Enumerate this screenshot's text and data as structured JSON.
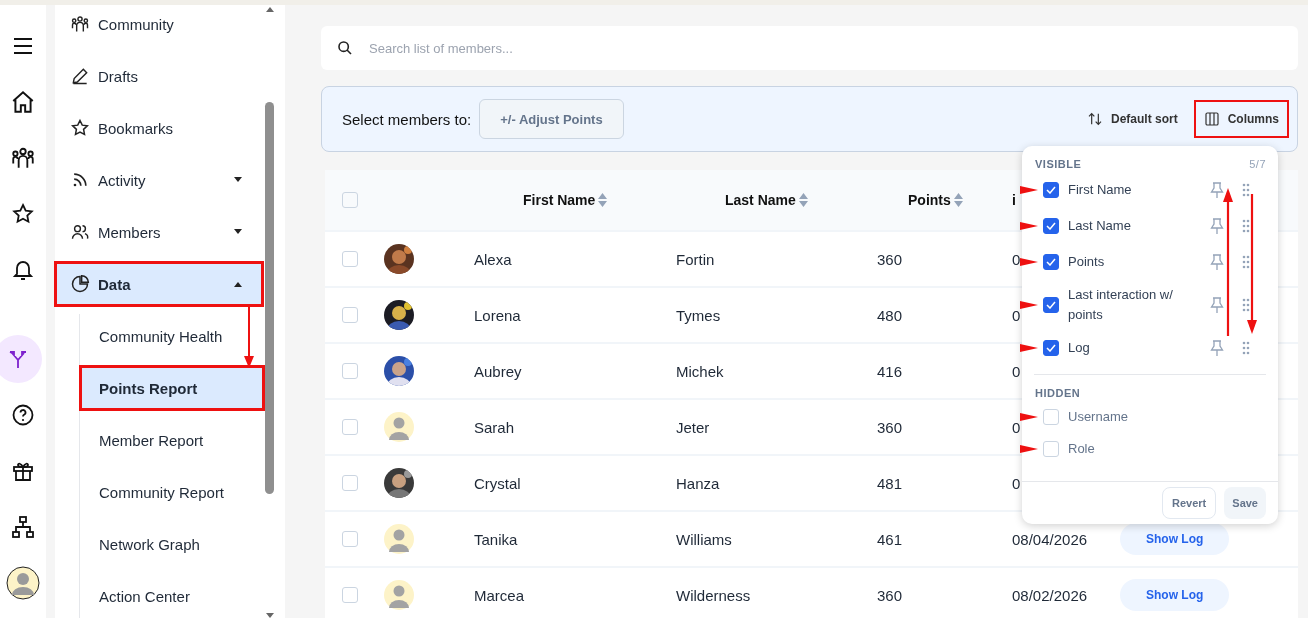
{
  "rail": [
    {
      "selected": false
    },
    {
      "selected": false
    },
    {
      "selected": false
    },
    {
      "selected": false
    },
    {
      "selected": false
    },
    {
      "selected": true
    },
    {
      "selected": false
    },
    {
      "selected": false
    },
    {
      "selected": false
    },
    {
      "selected": false
    }
  ],
  "sidebar": {
    "items": [
      {
        "label": "Community",
        "selected": false,
        "highlighted": false
      },
      {
        "label": "Drafts",
        "selected": false,
        "highlighted": false
      },
      {
        "label": "Bookmarks",
        "selected": false,
        "highlighted": false
      },
      {
        "label": "Activity",
        "has_menu": true,
        "expanded": false,
        "selected": false,
        "highlighted": false
      },
      {
        "label": "Members",
        "has_menu": true,
        "expanded": false,
        "selected": false,
        "highlighted": false
      },
      {
        "label": "Data",
        "has_menu": true,
        "expanded": true,
        "selected": true,
        "highlighted": true,
        "children": [
          {
            "label": "Community Health",
            "selected": false,
            "highlighted": false
          },
          {
            "label": "Points Report",
            "selected": true,
            "highlighted": true
          },
          {
            "label": "Member Report",
            "selected": false,
            "highlighted": false
          },
          {
            "label": "Community Report",
            "selected": false,
            "highlighted": false
          },
          {
            "label": "Network Graph",
            "selected": false,
            "highlighted": false
          },
          {
            "label": "Action Center",
            "selected": false,
            "highlighted": false
          }
        ]
      }
    ]
  },
  "search": {
    "placeholder": "Search list of members..."
  },
  "toolbar": {
    "label": "Select members to:",
    "action": {
      "label": "+/- Adjust Points",
      "disabled": true
    },
    "sort": "Default sort",
    "columns_button": {
      "label": "Columns",
      "highlighted": true
    }
  },
  "table": {
    "select_all": {
      "checked": false
    },
    "columns": [
      "First Name",
      "Last Name",
      "Points",
      "i"
    ],
    "rows": [
      {
        "first": "Alexa",
        "last": "Fortin",
        "points": "360",
        "column_4": "0",
        "checked": false
      },
      {
        "first": "Lorena",
        "last": "Tymes",
        "points": "480",
        "column_4": "0",
        "checked": false
      },
      {
        "first": "Aubrey",
        "last": "Michek",
        "points": "416",
        "column_4": "0",
        "checked": false
      },
      {
        "avatar": {
          "kind": "placeholder"
        },
        "first": "Sarah",
        "last": "Jeter",
        "points": "360",
        "column_4": "0",
        "checked": false
      },
      {
        "first": "Crystal",
        "last": "Hanza",
        "points": "481",
        "column_4": "0",
        "checked": false
      },
      {
        "avatar": {
          "kind": "placeholder"
        },
        "first": "Tanika",
        "last": "Williams",
        "points": "461",
        "column_4": "08/04/2026",
        "log": "Show Log",
        "checked": false
      },
      {
        "avatar": {
          "kind": "placeholder"
        },
        "first": "Marcea",
        "last": "Wilderness",
        "points": "360",
        "column_4": "08/02/2026",
        "log": "Show Log",
        "checked": false
      }
    ]
  },
  "columns_menu": {
    "visible_title": "VISIBLE",
    "count": "5/7",
    "hidden_title": "HIDDEN",
    "visible": [
      {
        "label": "First Name",
        "checked": true,
        "pointer": true
      },
      {
        "label": "Last Name",
        "checked": true,
        "pointer": true
      },
      {
        "label": "Points",
        "checked": true,
        "pointer": true
      },
      {
        "label": "Last interaction w/ points",
        "checked": true,
        "pointer": true
      },
      {
        "label": "Log",
        "checked": true,
        "pointer": true
      }
    ],
    "hidden": [
      {
        "label": "Username",
        "checked": false,
        "pointer": true
      },
      {
        "label": "Role",
        "checked": false,
        "pointer": true
      }
    ],
    "revert": "Revert",
    "save": {
      "label": "Save",
      "disabled": true
    }
  }
}
